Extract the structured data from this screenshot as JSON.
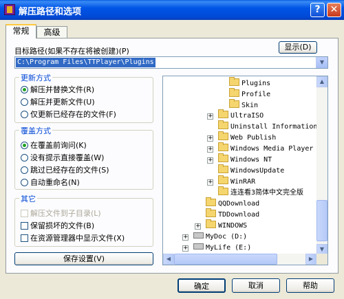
{
  "window": {
    "title": "解压路径和选项",
    "help_glyph": "?",
    "close_glyph": "✕"
  },
  "tabs": [
    {
      "label": "常规"
    },
    {
      "label": "高级"
    }
  ],
  "target": {
    "label": "目标路径(如果不存在将被创建)(P)",
    "show_button": "显示(D)",
    "value": "C:\\Program Files\\TTPlayer\\Plugins"
  },
  "update_group": {
    "title": "更新方式",
    "options": [
      {
        "label": "解压并替换文件(R)",
        "selected": true
      },
      {
        "label": "解压并更新文件(U)",
        "selected": false
      },
      {
        "label": "仅更新已经存在的文件(F)",
        "selected": false
      }
    ]
  },
  "overwrite_group": {
    "title": "覆盖方式",
    "options": [
      {
        "label": "在覆盖前询问(K)",
        "selected": true
      },
      {
        "label": "没有提示直接覆盖(W)",
        "selected": false
      },
      {
        "label": "跳过已经存在的文件(S)",
        "selected": false
      },
      {
        "label": "自动重命名(N)",
        "selected": false
      }
    ]
  },
  "other_group": {
    "title": "其它",
    "options": [
      {
        "label": "解压文件到子目录(L)",
        "checked": false,
        "disabled": true
      },
      {
        "label": "保留损坏的文件(B)",
        "checked": false,
        "disabled": false
      },
      {
        "label": "在资源管理器中显示文件(X)",
        "checked": false,
        "disabled": false
      }
    ]
  },
  "save_button": "保存设置(V)",
  "tree": [
    {
      "label": "Plugins",
      "icon": "folder-icon"
    },
    {
      "label": "Profile",
      "icon": "folder-icon"
    },
    {
      "label": "Skin",
      "icon": "folder-icon"
    },
    {
      "label": "UltraISO",
      "icon": "folder-icon"
    },
    {
      "label": "Uninstall Information",
      "icon": "folder-icon"
    },
    {
      "label": "Web Publish",
      "icon": "folder-icon"
    },
    {
      "label": "Windows Media Player",
      "icon": "folder-icon"
    },
    {
      "label": "Windows NT",
      "icon": "folder-icon"
    },
    {
      "label": "WindowsUpdate",
      "icon": "folder-icon"
    },
    {
      "label": "WinRAR",
      "icon": "folder-icon"
    },
    {
      "label": "连连看3简体中文完全版",
      "icon": "folder-icon"
    },
    {
      "label": "QQDownload",
      "icon": "folder-icon"
    },
    {
      "label": "TDDownload",
      "icon": "folder-icon"
    },
    {
      "label": "WINDOWS",
      "icon": "folder-icon"
    },
    {
      "label": "MyDoc (D:)",
      "icon": "drive-icon"
    },
    {
      "label": "MyLife (E:)",
      "icon": "drive-icon"
    }
  ],
  "footer": {
    "ok": "确定",
    "cancel": "取消",
    "help": "帮助"
  },
  "colors": {
    "titlebar": "#0055E6",
    "group_title": "#0046D5",
    "selection": "#316AC5",
    "dialog_bg": "#ECE9D8"
  }
}
